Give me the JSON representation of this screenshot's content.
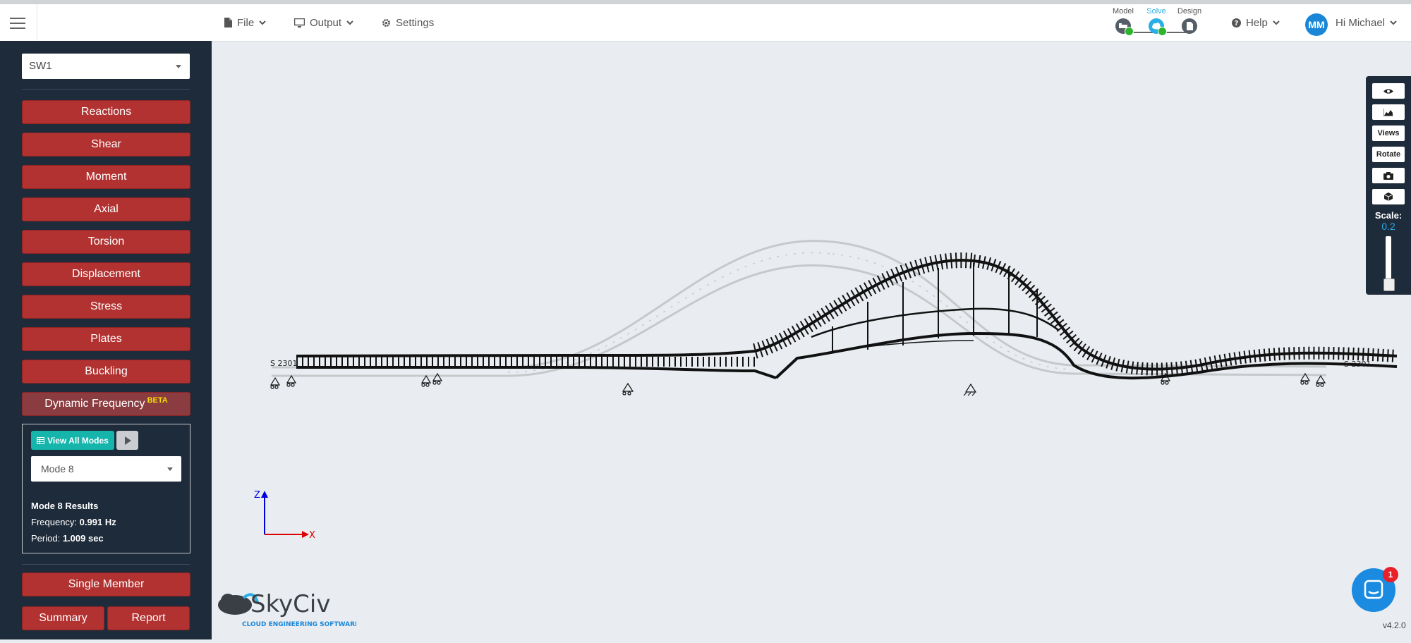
{
  "header": {
    "menu": [
      {
        "label": "File",
        "icon": "file-icon"
      },
      {
        "label": "Output",
        "icon": "monitor-icon"
      },
      {
        "label": "Settings",
        "icon": "gear-icon"
      }
    ],
    "stages": [
      {
        "label": "Model",
        "color": "#555d66"
      },
      {
        "label": "Solve",
        "color": "#29aee6"
      },
      {
        "label": "Design",
        "color": "#555d66"
      }
    ],
    "help_label": "Help",
    "avatar_initials": "MM",
    "greeting": "Hi Michael"
  },
  "sidebar": {
    "model_select": "SW1",
    "buttons": [
      "Reactions",
      "Shear",
      "Moment",
      "Axial",
      "Torsion",
      "Displacement",
      "Stress",
      "Plates",
      "Buckling"
    ],
    "dynamic_label": "Dynamic Frequency",
    "beta_label": "BETA",
    "view_all_modes_label": "View All Modes",
    "mode_select": "Mode 8",
    "results_title": "Mode 8 Results",
    "frequency_label": "Frequency:",
    "frequency_value": "0.991 Hz",
    "period_label": "Period:",
    "period_value": "1.009 sec",
    "single_member_label": "Single Member",
    "summary_label": "Summary",
    "report_label": "Report"
  },
  "canvas": {
    "axis_z": "Z",
    "axis_x": "X",
    "support_labels": {
      "left": "S 2301",
      "right": "S 2301"
    },
    "logo_text": "SkyCiv",
    "logo_tagline": "CLOUD ENGINEERING SOFTWARE"
  },
  "toolbar": {
    "views_label": "Views",
    "rotate_label": "Rotate",
    "scale_label": "Scale:",
    "scale_value": "0.2"
  },
  "chat_badge": "1",
  "version": "v4.2.0",
  "colors": {
    "accent_red": "#b23231",
    "sidebar_bg": "#1e2b3a",
    "teal": "#15b5ac",
    "blue": "#1a86d8"
  }
}
